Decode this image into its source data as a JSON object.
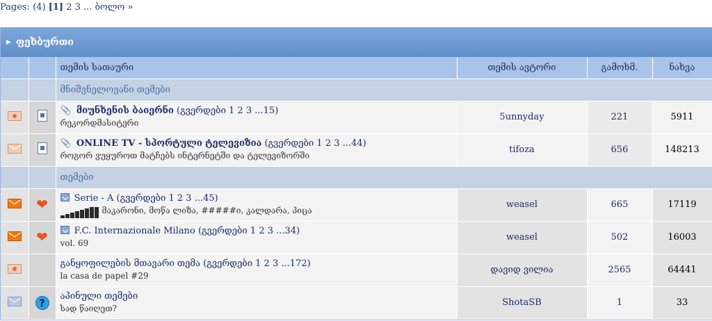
{
  "pagination": {
    "label": "Pages:",
    "count": "(4)",
    "current": "[1]",
    "p2": "2",
    "p3": "3",
    "ellipsis": "...",
    "last": "ბოლო »"
  },
  "category": {
    "title": "ფეხბურთი"
  },
  "columns": {
    "title": "თემის სათაური",
    "author": "თემის ავტორი",
    "views": "გამოხმ.",
    "replies": "ნახვა"
  },
  "sections": {
    "important": "მნიშვნელოვანი თემები",
    "topics": "თემები"
  },
  "rows": [
    {
      "title": "მიუნხენის ბაიერნი",
      "pages_open": "(გვერდები",
      "p1": "1",
      "p2": "2",
      "p3": "3",
      "plast": "...15",
      "pages_close": ")",
      "sub": "რეკორდმასიტერი",
      "author": "5unnyday",
      "views": "221",
      "replies": "5911"
    },
    {
      "title": "ONLINE TV - სპორტული ტელევიზია",
      "pages_open": "(გვერდები",
      "p1": "1",
      "p2": "2",
      "p3": "3",
      "plast": "...44",
      "pages_close": ")",
      "sub": "როგორ ვუყუროთ მატჩებს ინტერნეტში და ტელევიზორში",
      "author": "tifoza",
      "views": "656",
      "replies": "148213"
    },
    {
      "title": "Serie - A",
      "pages_open": "(გვერდები",
      "p1": "1",
      "p2": "2",
      "p3": "3",
      "plast": "...45",
      "pages_close": ")",
      "sub": "მაკარონი, მოწა ლიზა, #####ი, კალდარა, პიცა",
      "author": "weasel",
      "views": "665",
      "replies": "17119"
    },
    {
      "title": "F.C. Internazionale Milano",
      "pages_open": "(გვერდები",
      "p1": "1",
      "p2": "2",
      "p3": "3",
      "plast": "...34",
      "pages_close": ")",
      "sub": "vol. 69",
      "author": "weasel",
      "views": "502",
      "replies": "16003"
    },
    {
      "title": "განყოფილების მთავარი თემა",
      "pages_open": "(გვერდები",
      "p1": "1",
      "p2": "2",
      "p3": "3",
      "plast": "...172",
      "pages_close": ")",
      "sub": "la casa de papel #29",
      "author": "დავიდ ვილია",
      "views": "2565",
      "replies": "64441"
    },
    {
      "title": "აპინული თემები",
      "sub": "სად წაიღეთ?",
      "author": "ShotaSB",
      "views": "1",
      "replies": "33"
    }
  ]
}
